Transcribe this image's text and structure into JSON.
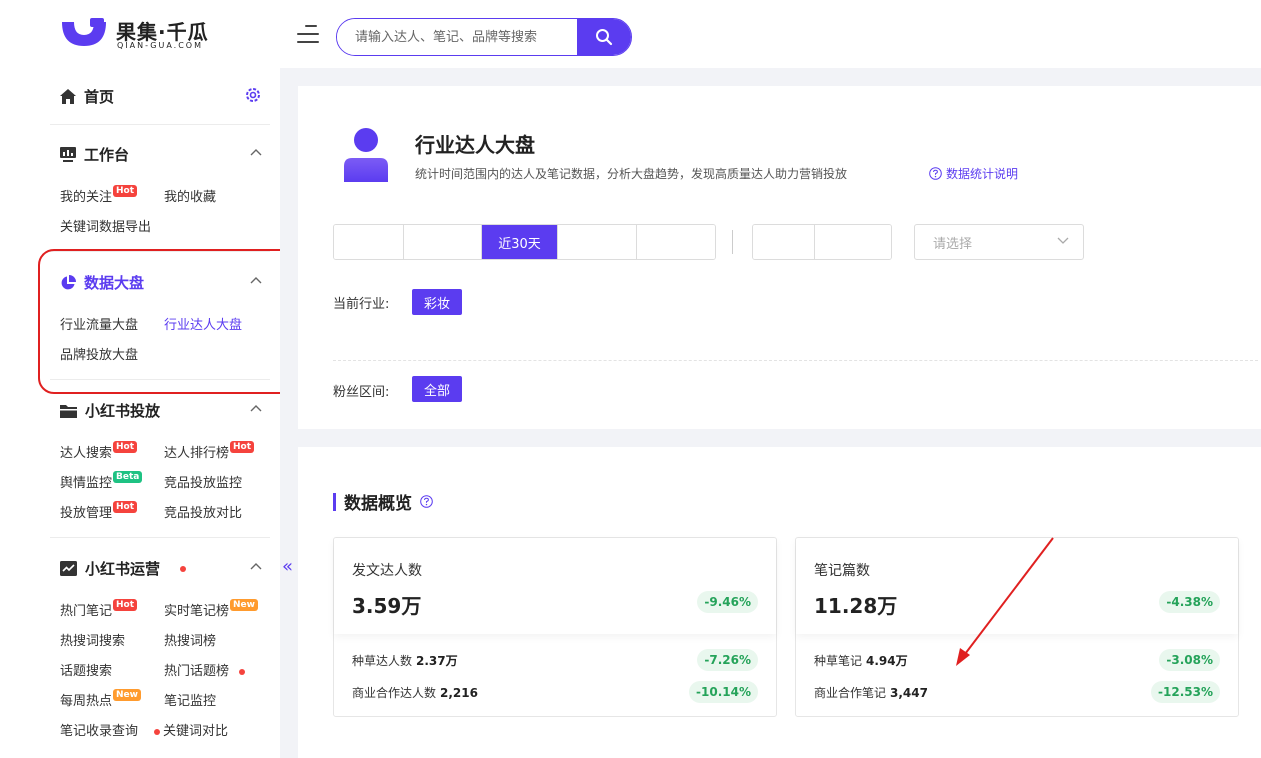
{
  "header": {
    "logo_cn": "果集·千瓜",
    "logo_en": "QIAN-GUA.COM",
    "search_placeholder": "请输入达人、笔记、品牌等搜索"
  },
  "sidebar": {
    "home": "首页",
    "workbench": {
      "title": "工作台",
      "items": [
        "我的关注",
        "我的收藏",
        "关键词数据导出"
      ],
      "badges": [
        "Hot"
      ]
    },
    "dashboard": {
      "title": "数据大盘",
      "items": [
        "行业流量大盘",
        "行业达人大盘",
        "品牌投放大盘"
      ]
    },
    "xhs_ads": {
      "title": "小红书投放",
      "items": [
        "达人搜索",
        "达人排行榜",
        "舆情监控",
        "竞品投放监控",
        "投放管理",
        "竞品投放对比"
      ],
      "badges": [
        "Hot",
        "Hot",
        "Beta",
        "Hot"
      ]
    },
    "xhs_ops": {
      "title": "小红书运营",
      "items": [
        "热门笔记",
        "实时笔记榜",
        "热搜词搜索",
        "热搜词榜",
        "话题搜索",
        "热门话题榜",
        "每周热点",
        "笔记监控",
        "笔记收录查询",
        "关键词对比"
      ],
      "badges": [
        "Hot",
        "New",
        "New"
      ]
    },
    "collapse_glyph": "«"
  },
  "main": {
    "title": "行业达人大盘",
    "description": "统计时间范围内的达人及笔记数据，分析大盘趋势，发现高质量达人助力营销投放",
    "help_link": "数据统计说明",
    "date_segments": [
      "",
      "",
      "近30天",
      "",
      ""
    ],
    "date_segments2": [
      "",
      ""
    ],
    "select_placeholder": "请选择",
    "industry_label": "当前行业:",
    "industry_value": "彩妆",
    "fans_label": "粉丝区间:",
    "fans_value": "全部",
    "overview_title": "数据概览",
    "cards": [
      {
        "label": "发文达人数",
        "value": "3.59万",
        "change": "-9.46%",
        "sub": [
          {
            "label": "种草达人数",
            "value": "2.37万",
            "change": "-7.26%"
          },
          {
            "label": "商业合作达人数",
            "value": "2,216",
            "change": "-10.14%"
          }
        ]
      },
      {
        "label": "笔记篇数",
        "value": "11.28万",
        "change": "-4.38%",
        "sub": [
          {
            "label": "种草笔记",
            "value": "4.94万",
            "change": "-3.08%"
          },
          {
            "label": "商业合作笔记",
            "value": "3,447",
            "change": "-12.53%"
          }
        ]
      }
    ]
  },
  "colors": {
    "accent": "#5b3cf0",
    "hot": "#f5433d",
    "beta": "#1ec283",
    "new": "#ff9b2e",
    "change_text": "#25a35a",
    "change_bg": "#e9f7ee",
    "annotation": "#e02020"
  }
}
